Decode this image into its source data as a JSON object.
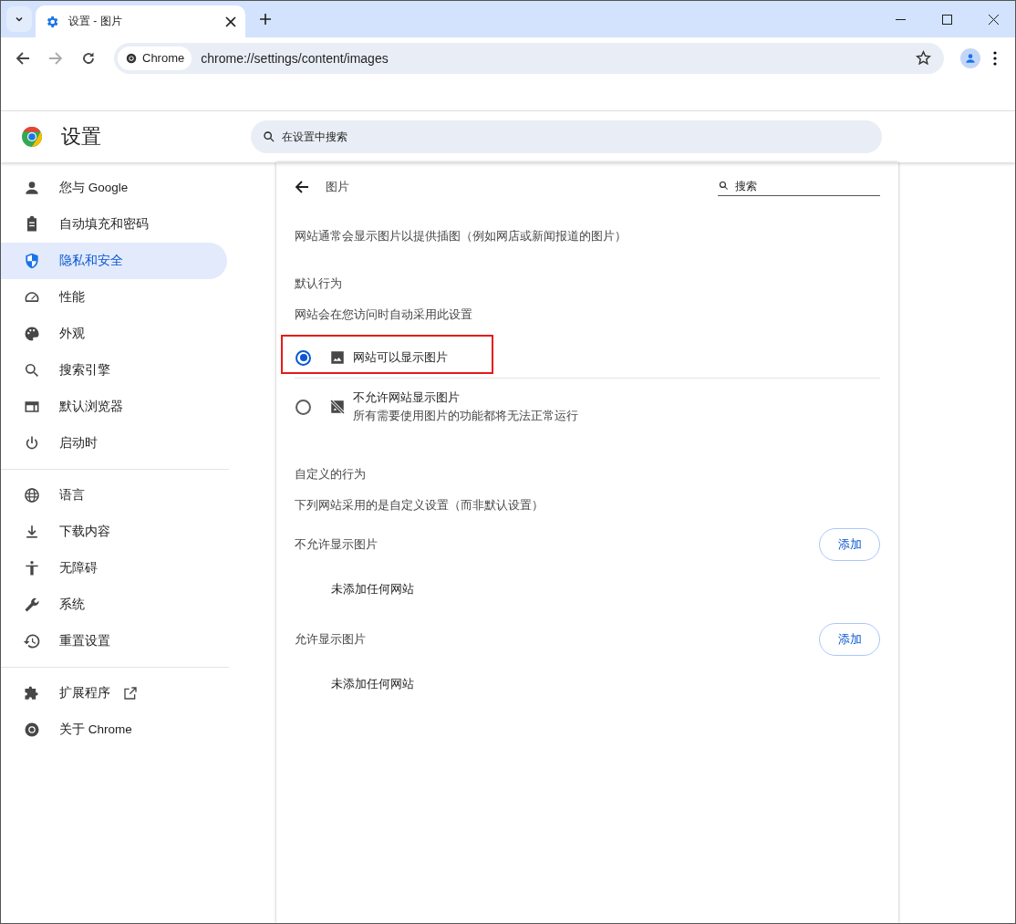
{
  "window": {
    "tab_title": "设置 - 图片",
    "address_chip": "Chrome",
    "url": "chrome://settings/content/images"
  },
  "header": {
    "title": "设置",
    "search_placeholder": "在设置中搜索"
  },
  "sidebar": {
    "groups": [
      [
        {
          "label": "您与 Google",
          "kind": "person",
          "selected": false
        },
        {
          "label": "自动填充和密码",
          "kind": "clipboard",
          "selected": false
        },
        {
          "label": "隐私和安全",
          "kind": "shield",
          "selected": true
        },
        {
          "label": "性能",
          "kind": "gauge",
          "selected": false
        },
        {
          "label": "外观",
          "kind": "palette",
          "selected": false
        },
        {
          "label": "搜索引擎",
          "kind": "search",
          "selected": false
        },
        {
          "label": "默认浏览器",
          "kind": "browser",
          "selected": false
        },
        {
          "label": "启动时",
          "kind": "power",
          "selected": false
        }
      ],
      [
        {
          "label": "语言",
          "kind": "globe",
          "selected": false
        },
        {
          "label": "下载内容",
          "kind": "download",
          "selected": false
        },
        {
          "label": "无障碍",
          "kind": "accessibility",
          "selected": false
        },
        {
          "label": "系统",
          "kind": "wrench",
          "selected": false
        },
        {
          "label": "重置设置",
          "kind": "history",
          "selected": false
        }
      ],
      [
        {
          "label": "扩展程序",
          "kind": "puzzle",
          "selected": false,
          "external": true
        },
        {
          "label": "关于 Chrome",
          "kind": "chrome",
          "selected": false,
          "external": false
        }
      ]
    ]
  },
  "page": {
    "title": "图片",
    "search_placeholder": "搜索",
    "description": "网站通常会显示图片以提供插图（例如网店或新闻报道的图片）",
    "default_heading": "默认行为",
    "default_sub": "网站会在您访问时自动采用此设置",
    "options": [
      {
        "label": "网站可以显示图片",
        "kind": "image",
        "selected": true,
        "highlighted": true
      },
      {
        "label": "不允许网站显示图片",
        "sublabel": "所有需要使用图片的功能都将无法正常运行",
        "kind": "image-off",
        "selected": false,
        "highlighted": false
      }
    ],
    "custom_heading": "自定义的行为",
    "custom_sub": "下列网站采用的是自定义设置（而非默认设置）",
    "lists": [
      {
        "title": "不允许显示图片",
        "button": "添加",
        "empty": "未添加任何网站"
      },
      {
        "title": "允许显示图片",
        "button": "添加",
        "empty": "未添加任何网站"
      }
    ]
  }
}
